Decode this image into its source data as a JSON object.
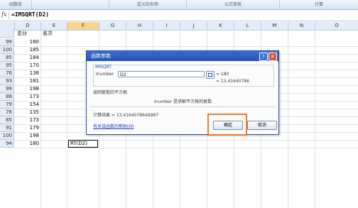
{
  "ribbon": {
    "groups": [
      "函数库",
      "定义的名称",
      "公式审核",
      "计算"
    ]
  },
  "formula_bar": {
    "fx_label": "fx",
    "formula": "=IMSQRT(D2)"
  },
  "columns": [
    "D",
    "E",
    "F",
    "G",
    "H",
    "I",
    "J",
    "K",
    "L",
    "M",
    "N",
    "O"
  ],
  "selected_column": "F",
  "header_row": {
    "d": "总分",
    "e": "名次"
  },
  "rows": [
    {
      "row": "99",
      "d": "180"
    },
    {
      "row": "100",
      "d": "185"
    },
    {
      "row": "85",
      "d": "184"
    },
    {
      "row": "95",
      "d": "170"
    },
    {
      "row": "76",
      "d": "138"
    },
    {
      "row": "93",
      "d": "181"
    },
    {
      "row": "99",
      "d": "198"
    },
    {
      "row": "88",
      "d": "173"
    },
    {
      "row": "79",
      "d": "154"
    },
    {
      "row": "76",
      "d": "135"
    },
    {
      "row": "85",
      "d": "173"
    },
    {
      "row": "91",
      "d": "179"
    },
    {
      "row": "100",
      "d": "198"
    },
    {
      "row": "94",
      "d": "180",
      "f": "RT(D2)"
    }
  ],
  "dialog": {
    "title": "函数参数",
    "help_icon": "question-icon",
    "close_icon": "close-icon",
    "function_name": "IMSQRT",
    "arg_label": "Inumber",
    "arg_value": "D2",
    "arg_result": "= 180",
    "func_result": "= 13.41640786",
    "description": "返回复数的平方根",
    "arg_desc": "Inumber  是求解平方根的复数",
    "calc_result": "计算结果 = 13.4164078649987",
    "help_link": "有关该函数的帮助(H)",
    "ok_label": "确定",
    "cancel_label": "取消",
    "highlight_color": "#f07a2a"
  }
}
